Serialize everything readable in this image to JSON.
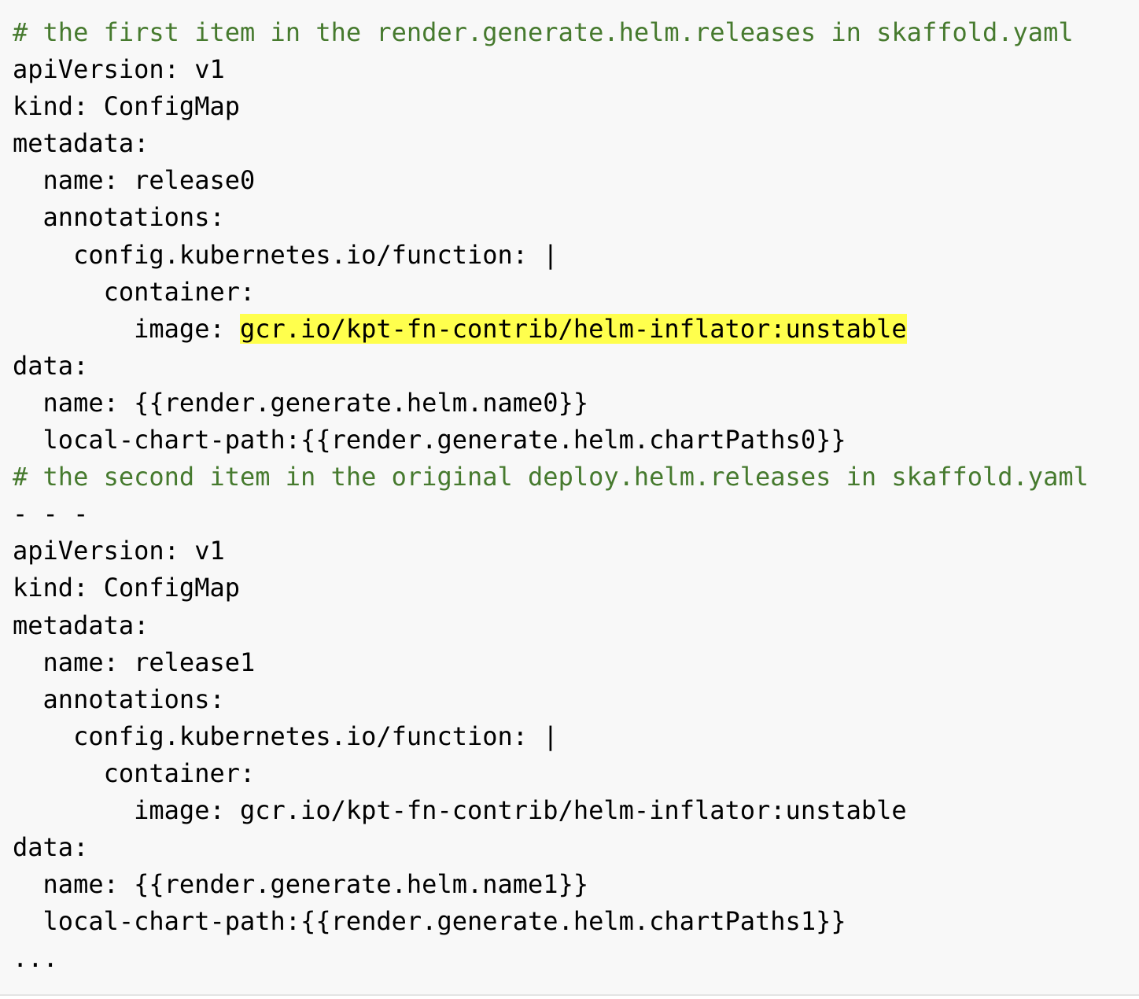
{
  "colors": {
    "background": "#f8f8f8",
    "text": "#000000",
    "comment": "#467a2e",
    "highlight": "#ffff4d"
  },
  "lines": [
    {
      "indent": "",
      "text": "# the first item in the render.generate.helm.releases in skaffold.yaml",
      "kind": "comment"
    },
    {
      "indent": "",
      "text": "apiVersion: v1",
      "kind": "code"
    },
    {
      "indent": "",
      "text": "kind: ConfigMap",
      "kind": "code"
    },
    {
      "indent": "",
      "text": "metadata:",
      "kind": "code"
    },
    {
      "indent": "  ",
      "text": "name: release0",
      "kind": "code"
    },
    {
      "indent": "  ",
      "text": "annotations:",
      "kind": "code"
    },
    {
      "indent": "    ",
      "text": "config.kubernetes.io/function: |",
      "kind": "code"
    },
    {
      "indent": "      ",
      "text": "container:",
      "kind": "code"
    },
    {
      "indent": "        ",
      "text": "image: ",
      "highlight": "gcr.io/kpt-fn-contrib/helm-inflator:unstable",
      "kind": "code"
    },
    {
      "indent": "",
      "text": "data:",
      "kind": "code"
    },
    {
      "indent": "  ",
      "text": "name: {{render.generate.helm.name0}}",
      "kind": "code"
    },
    {
      "indent": "  ",
      "text": "local-chart-path:{{render.generate.helm.chartPaths0}}",
      "kind": "code"
    },
    {
      "indent": "",
      "text": "# the second item in the original deploy.helm.releases in skaffold.yaml",
      "kind": "comment"
    },
    {
      "indent": "",
      "text": "- - -",
      "kind": "code"
    },
    {
      "indent": "",
      "text": "apiVersion: v1",
      "kind": "code"
    },
    {
      "indent": "",
      "text": "kind: ConfigMap",
      "kind": "code"
    },
    {
      "indent": "",
      "text": "metadata:",
      "kind": "code"
    },
    {
      "indent": "  ",
      "text": "name: release1",
      "kind": "code"
    },
    {
      "indent": "  ",
      "text": "annotations:",
      "kind": "code"
    },
    {
      "indent": "    ",
      "text": "config.kubernetes.io/function: |",
      "kind": "code"
    },
    {
      "indent": "      ",
      "text": "container:",
      "kind": "code"
    },
    {
      "indent": "        ",
      "text": "image: gcr.io/kpt-fn-contrib/helm-inflator:unstable",
      "kind": "code"
    },
    {
      "indent": "",
      "text": "data:",
      "kind": "code"
    },
    {
      "indent": "  ",
      "text": "name: {{render.generate.helm.name1}}",
      "kind": "code"
    },
    {
      "indent": "  ",
      "text": "local-chart-path:{{render.generate.helm.chartPaths1}}",
      "kind": "code"
    },
    {
      "indent": "",
      "text": "...",
      "kind": "code"
    }
  ]
}
